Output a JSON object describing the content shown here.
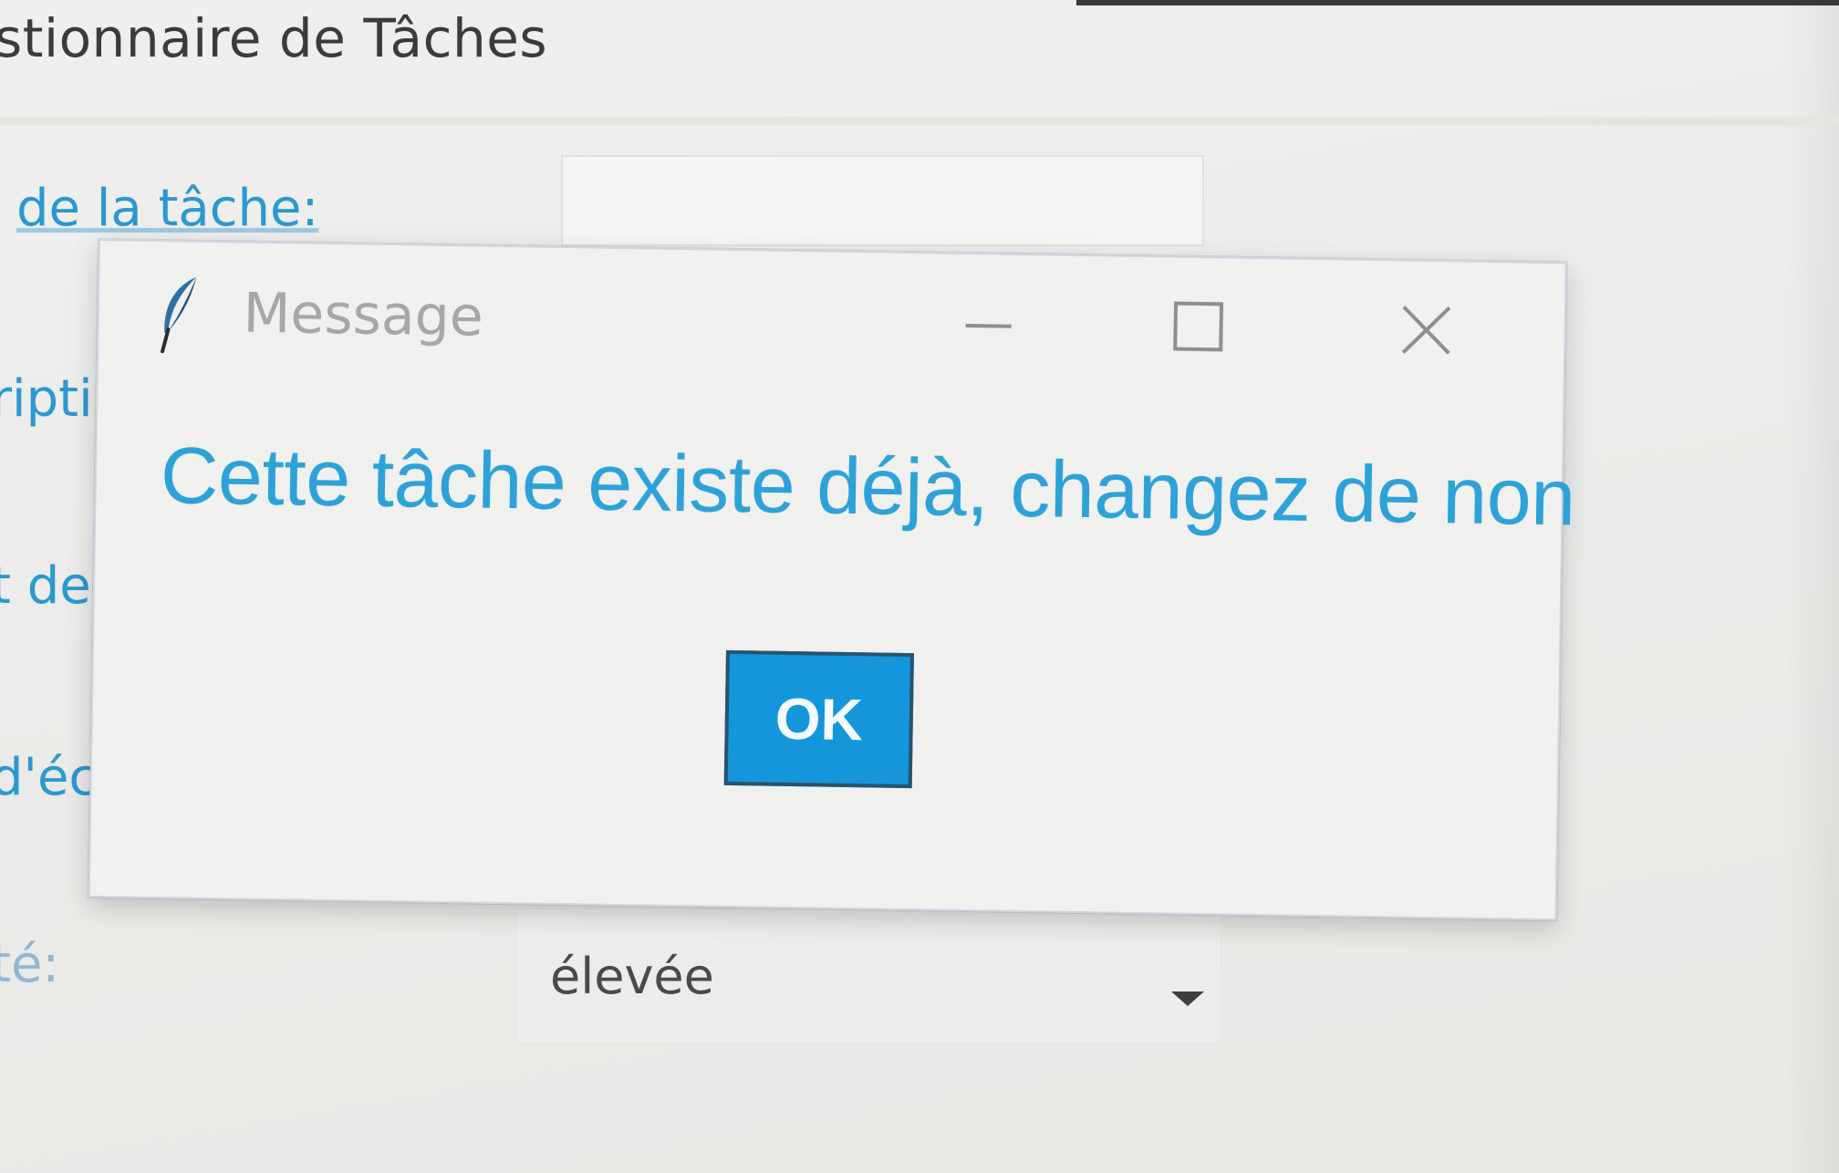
{
  "app": {
    "title_fragment": "stionnaire de Tâches"
  },
  "form": {
    "labels": {
      "name": "de la tâche:",
      "description": "ripti",
      "start_date": "t de",
      "end_date": "d'éc",
      "priority": "té:"
    },
    "name_input_value": "",
    "priority_selected": "élevée"
  },
  "dialog": {
    "title": "Message",
    "message": "Cette tâche existe déjà, changez de non",
    "ok_label": "OK",
    "icons": {
      "app_icon": "feather-icon",
      "minimize": "minimize-icon",
      "maximize": "maximize-icon",
      "close": "close-icon"
    }
  }
}
